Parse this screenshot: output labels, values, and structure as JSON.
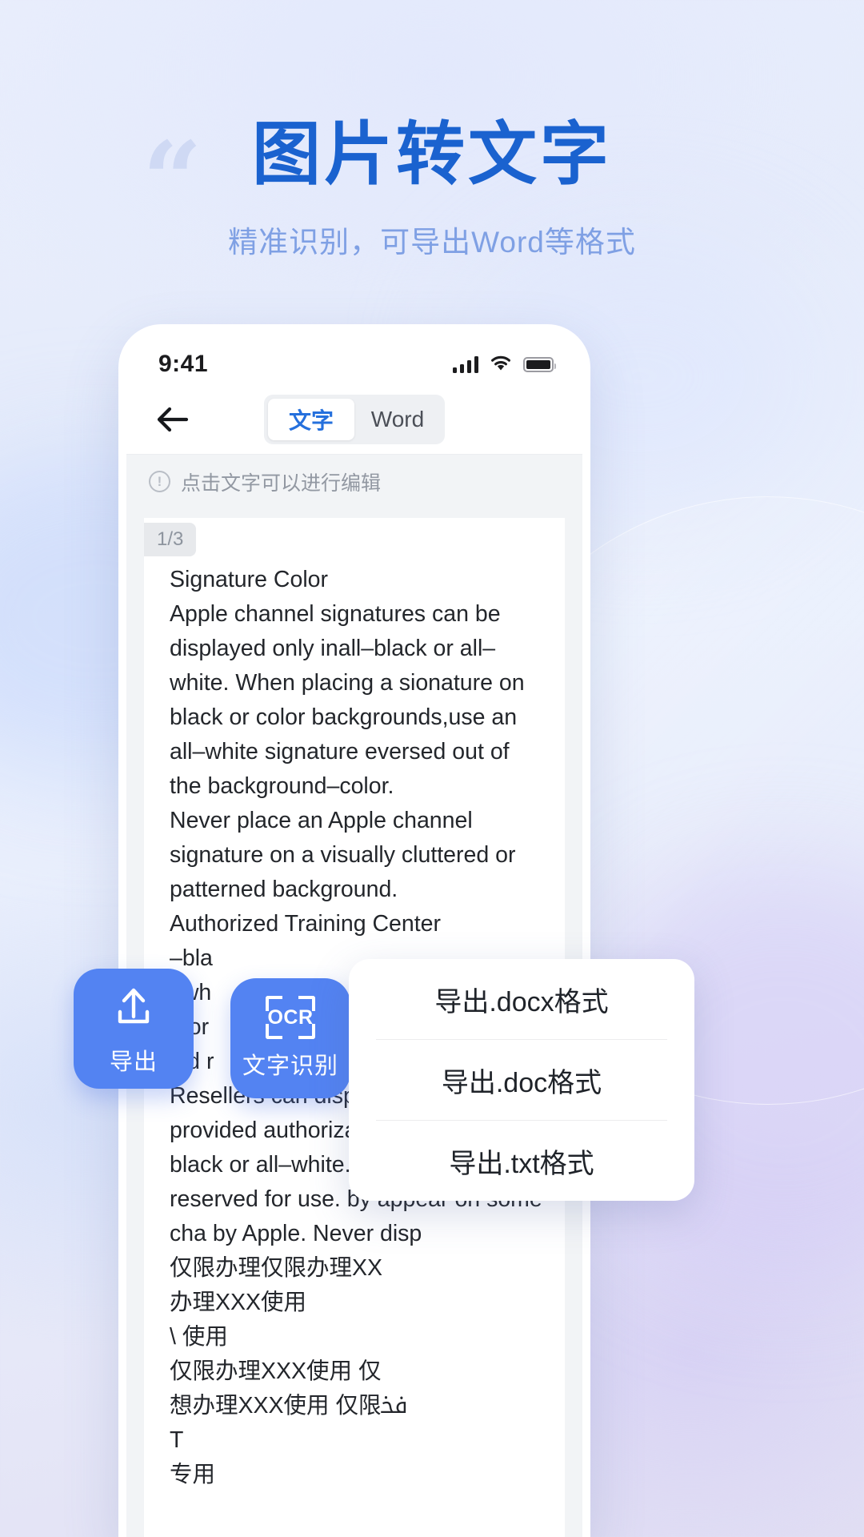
{
  "hero": {
    "quote_mark": "“",
    "title": "图片转文字",
    "subtitle": "精准识别，可导出Word等格式"
  },
  "phone": {
    "status": {
      "time": "9:41",
      "signal_icon": "signal-bars-icon",
      "wifi_icon": "wifi-icon",
      "battery_icon": "battery-icon"
    },
    "navbar": {
      "back_icon": "back-arrow-icon",
      "tabs": [
        {
          "label": "文字",
          "active": true
        },
        {
          "label": "Word",
          "active": false
        }
      ]
    },
    "hint": {
      "icon": "info-circle-icon",
      "icon_glyph": "!",
      "text": "点击文字可以进行编辑"
    },
    "document": {
      "page_badge": "1/3",
      "text": "Signature Color\nApple channel signatures can be displayed only inall–black or all–white. When placing a sionature on black or color backgrounds,use an all–white signature eversed out of the background–color.\nNever place an Apple channel signature on a visually cluttered or patterned background.\nAuthorized Training Center\n–bla\n–wh\nthor\nold r\nResellers can display their Apple–provided authorization only in all–black or all–white. An Apple l reserved for use. by appear on some cha by Apple. Never disp\n仅限办理仅限办理XX\n办理XXX使用\n\\ 使用\n仅限办理XXX使用 仅\n想办理XXX使用 仅限ﳀ\nT\n专用"
    }
  },
  "fabs": [
    {
      "name": "export",
      "icon": "upload-icon",
      "label": "导出",
      "color": "#5383f2"
    },
    {
      "name": "ocr",
      "icon": "ocr-scan-icon",
      "icon_text": "OCR",
      "label": "文字识别",
      "color": "#5383f2"
    }
  ],
  "export_menu": {
    "items": [
      {
        "label": "导出.docx格式"
      },
      {
        "label": "导出.doc格式"
      },
      {
        "label": "导出.txt格式"
      }
    ]
  },
  "colors": {
    "accent": "#1a62cf",
    "fab": "#5383f2",
    "subtitle": "#7fa0e4",
    "tab_active": "#2570dd"
  }
}
